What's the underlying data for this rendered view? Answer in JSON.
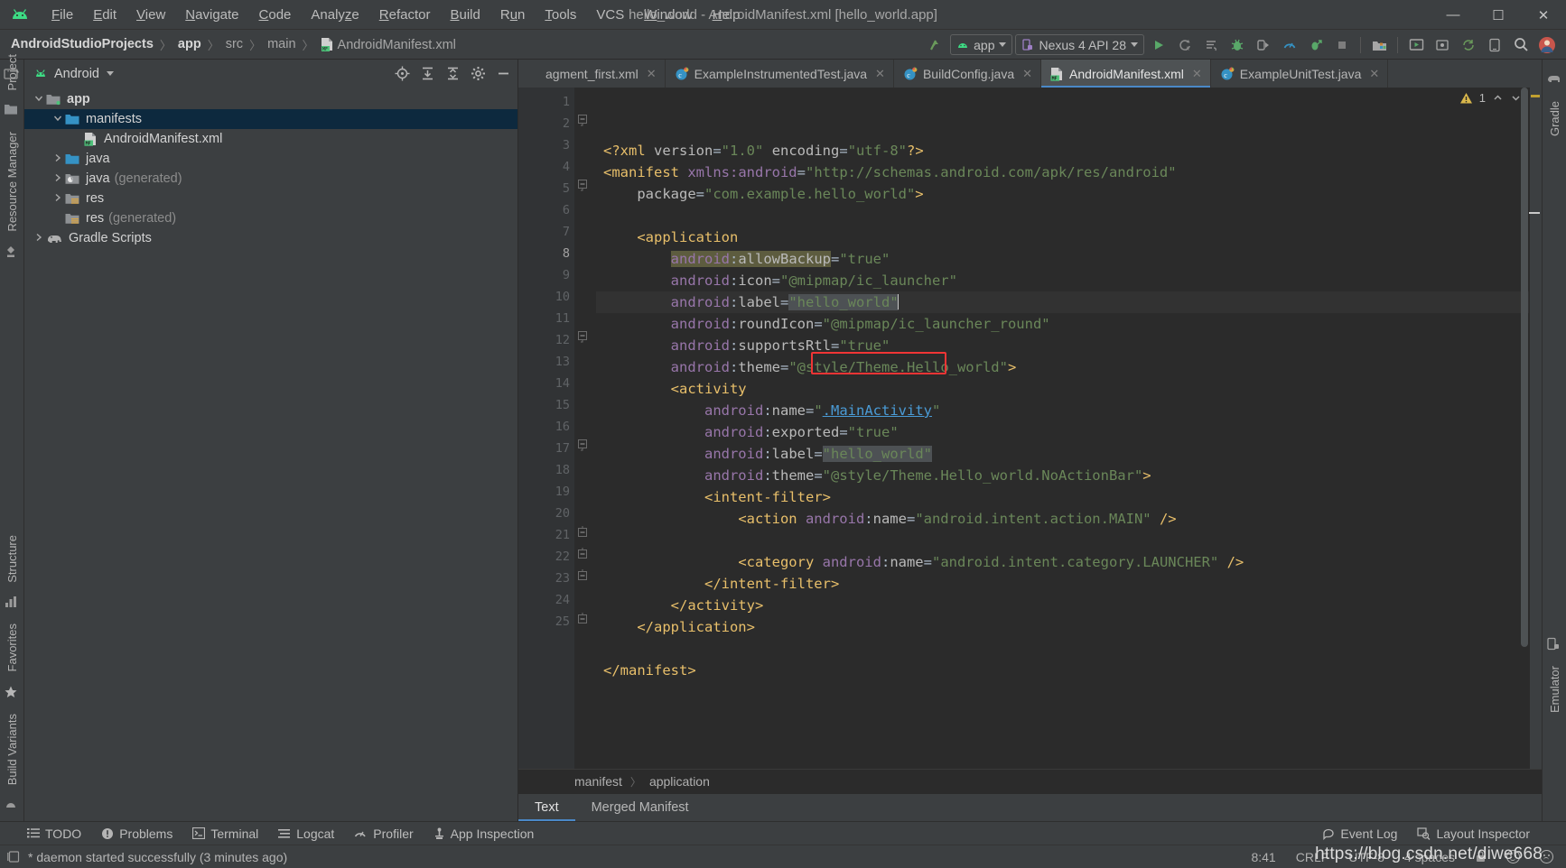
{
  "window": {
    "title": "hello_world - AndroidManifest.xml [hello_world.app]",
    "minimize": "—",
    "maximize": "☐",
    "close": "✕"
  },
  "menu": {
    "items": [
      {
        "label": "File",
        "mnemonic": "F"
      },
      {
        "label": "Edit",
        "mnemonic": "E"
      },
      {
        "label": "View",
        "mnemonic": "V"
      },
      {
        "label": "Navigate",
        "mnemonic": "N"
      },
      {
        "label": "Code",
        "mnemonic": "C"
      },
      {
        "label": "Analyze",
        "mnemonic": "z"
      },
      {
        "label": "Refactor",
        "mnemonic": "R"
      },
      {
        "label": "Build",
        "mnemonic": "B"
      },
      {
        "label": "Run",
        "mnemonic": "u"
      },
      {
        "label": "Tools",
        "mnemonic": "T"
      },
      {
        "label": "VCS",
        "mnemonic": ""
      },
      {
        "label": "Window",
        "mnemonic": "W"
      },
      {
        "label": "Help",
        "mnemonic": "H"
      }
    ]
  },
  "navbar": {
    "breadcrumbs": [
      "AndroidStudioProjects",
      "app",
      "src",
      "main",
      "AndroidManifest.xml"
    ],
    "separator": "〉",
    "module_selector": "app",
    "device_selector": "Nexus 4 API 28",
    "icons": [
      "make-project-icon",
      "run-icon",
      "run-with-coverage-icon",
      "apply-changes-icon",
      "debug-icon",
      "attach-debugger-icon",
      "profiler-icon",
      "debug-attach-icon",
      "stop-icon",
      "sdk-manager-icon",
      "avd-manager-icon",
      "search-everywhere-icon",
      "profile-avatar-icon"
    ]
  },
  "leftstrip": {
    "labels": [
      "Project",
      "Resource Manager",
      "Structure",
      "Favorites",
      "Build Variants"
    ],
    "icons": [
      "project-icon",
      "resource-manager-icon",
      "structure-icon",
      "favorites-star-icon",
      "build-variants-icon"
    ]
  },
  "rightstrip": {
    "labels": [
      "Gradle",
      "Emulator"
    ],
    "icons": [
      "gradle-elephant-icon",
      "emulator-icon"
    ]
  },
  "project_panel": {
    "view_selector": "Android",
    "tool_icons": [
      "locate-icon",
      "expand-all-icon",
      "collapse-all-icon",
      "settings-gear-icon",
      "hide-icon"
    ],
    "tree": [
      {
        "label": "app",
        "depth": 0,
        "arrow": "down",
        "icon": "module-folder-icon",
        "bold": true,
        "dim": "",
        "selected": false
      },
      {
        "label": "manifests",
        "depth": 1,
        "arrow": "down",
        "icon": "folder-icon",
        "bold": false,
        "dim": "",
        "selected": true
      },
      {
        "label": "AndroidManifest.xml",
        "depth": 2,
        "arrow": "none",
        "icon": "manifest-file-icon",
        "bold": false,
        "dim": "",
        "selected": false
      },
      {
        "label": "java",
        "depth": 1,
        "arrow": "right",
        "icon": "folder-icon",
        "bold": false,
        "dim": "",
        "selected": false
      },
      {
        "label": "java",
        "depth": 1,
        "arrow": "right",
        "icon": "folder-generated-icon",
        "bold": false,
        "dim": "(generated)",
        "selected": false
      },
      {
        "label": "res",
        "depth": 1,
        "arrow": "right",
        "icon": "res-folder-icon",
        "bold": false,
        "dim": "",
        "selected": false
      },
      {
        "label": "res",
        "depth": 1,
        "arrow": "none",
        "icon": "res-folder-icon",
        "bold": false,
        "dim": "(generated)",
        "selected": false
      },
      {
        "label": "Gradle Scripts",
        "depth": 0,
        "arrow": "right",
        "icon": "gradle-elephant-icon",
        "bold": false,
        "dim": "",
        "selected": false
      }
    ]
  },
  "editor": {
    "tabs": [
      {
        "label": "agment_first.xml",
        "icon": "xml-layout-icon",
        "active": false,
        "closable": true
      },
      {
        "label": "ExampleInstrumentedTest.java",
        "icon": "java-class-icon",
        "active": false,
        "closable": true
      },
      {
        "label": "BuildConfig.java",
        "icon": "java-class-icon",
        "active": false,
        "closable": true
      },
      {
        "label": "AndroidManifest.xml",
        "icon": "manifest-file-icon",
        "active": true,
        "closable": true
      },
      {
        "label": "ExampleUnitTest.java",
        "icon": "java-class-icon",
        "active": false,
        "closable": true
      }
    ],
    "tab_overflow_icon": "chevron-down-icon",
    "warning_count": "1",
    "warning_icon": "warning-triangle-icon",
    "inspection_up_icon": "chevron-up-icon",
    "inspection_down_icon": "chevron-down-icon",
    "settings_icon": "settings-gear-icon",
    "hide_icon": "hide-minus-icon",
    "cursor_line": 8,
    "lines": [
      {
        "n": 1,
        "gmark": "",
        "fold": "",
        "current": false,
        "parts": [
          {
            "t": "<?xml ",
            "c": "tag"
          },
          {
            "t": "version",
            "c": "attrn"
          },
          {
            "t": "=",
            "c": "punc"
          },
          {
            "t": "\"1.0\"",
            "c": "val"
          },
          {
            "t": " ",
            "c": "punc"
          },
          {
            "t": "encoding",
            "c": "attrn"
          },
          {
            "t": "=",
            "c": "punc"
          },
          {
            "t": "\"utf-8\"",
            "c": "val"
          },
          {
            "t": "?>",
            "c": "tag"
          }
        ]
      },
      {
        "n": 2,
        "gmark": "",
        "fold": "minus",
        "current": false,
        "parts": [
          {
            "t": "<manifest ",
            "c": "tag"
          },
          {
            "t": "xmlns:android",
            "c": "ns"
          },
          {
            "t": "=",
            "c": "punc"
          },
          {
            "t": "\"http://schemas.android.com/apk/res/android\"",
            "c": "val"
          }
        ]
      },
      {
        "n": 3,
        "gmark": "",
        "fold": "",
        "current": false,
        "parts": [
          {
            "t": "    ",
            "c": "punc"
          },
          {
            "t": "package",
            "c": "attrn"
          },
          {
            "t": "=",
            "c": "punc"
          },
          {
            "t": "\"com.example.hello_world\"",
            "c": "val"
          },
          {
            "t": ">",
            "c": "tag"
          }
        ]
      },
      {
        "n": 4,
        "gmark": "",
        "fold": "",
        "current": false,
        "parts": []
      },
      {
        "n": 5,
        "gmark": "",
        "fold": "minus",
        "current": false,
        "parts": [
          {
            "t": "    ",
            "c": "punc"
          },
          {
            "t": "<application",
            "c": "tag"
          }
        ]
      },
      {
        "n": 6,
        "gmark": "",
        "fold": "",
        "current": false,
        "parts": [
          {
            "t": "        ",
            "c": "punc"
          },
          {
            "t": "android",
            "c": "ns hl-bg"
          },
          {
            "t": ":",
            "c": "punc hl-bg"
          },
          {
            "t": "allowBackup",
            "c": "attrn hl-bg"
          },
          {
            "t": "=",
            "c": "punc"
          },
          {
            "t": "\"true\"",
            "c": "val"
          }
        ]
      },
      {
        "n": 7,
        "gmark": "image",
        "fold": "",
        "current": false,
        "parts": [
          {
            "t": "        ",
            "c": "punc"
          },
          {
            "t": "android",
            "c": "ns"
          },
          {
            "t": ":",
            "c": "punc"
          },
          {
            "t": "icon",
            "c": "attrn"
          },
          {
            "t": "=",
            "c": "punc"
          },
          {
            "t": "\"@mipmap/ic_launcher\"",
            "c": "val"
          }
        ]
      },
      {
        "n": 8,
        "gmark": "",
        "fold": "",
        "current": true,
        "parts": [
          {
            "t": "        ",
            "c": "punc"
          },
          {
            "t": "android",
            "c": "ns"
          },
          {
            "t": ":",
            "c": "punc"
          },
          {
            "t": "label",
            "c": "attrn"
          },
          {
            "t": "=",
            "c": "punc"
          },
          {
            "t": "\"hello_world\"",
            "c": "val sel-bg"
          },
          {
            "t": "|CARET|",
            "c": "caret"
          }
        ]
      },
      {
        "n": 9,
        "gmark": "image",
        "fold": "",
        "current": false,
        "parts": [
          {
            "t": "        ",
            "c": "punc"
          },
          {
            "t": "android",
            "c": "ns"
          },
          {
            "t": ":",
            "c": "punc"
          },
          {
            "t": "roundIcon",
            "c": "attrn"
          },
          {
            "t": "=",
            "c": "punc"
          },
          {
            "t": "\"@mipmap/ic_launcher_round\"",
            "c": "val"
          }
        ]
      },
      {
        "n": 10,
        "gmark": "",
        "fold": "",
        "current": false,
        "parts": [
          {
            "t": "        ",
            "c": "punc"
          },
          {
            "t": "android",
            "c": "ns"
          },
          {
            "t": ":",
            "c": "punc"
          },
          {
            "t": "supportsRtl",
            "c": "attrn"
          },
          {
            "t": "=",
            "c": "punc"
          },
          {
            "t": "\"true\"",
            "c": "val"
          }
        ]
      },
      {
        "n": 11,
        "gmark": "",
        "fold": "",
        "current": false,
        "parts": [
          {
            "t": "        ",
            "c": "punc"
          },
          {
            "t": "android",
            "c": "ns"
          },
          {
            "t": ":",
            "c": "punc"
          },
          {
            "t": "theme",
            "c": "attrn"
          },
          {
            "t": "=",
            "c": "punc"
          },
          {
            "t": "\"@style/Theme.Hello_world\"",
            "c": "val"
          },
          {
            "t": ">",
            "c": "tag"
          }
        ]
      },
      {
        "n": 12,
        "gmark": "",
        "fold": "minus",
        "current": false,
        "parts": [
          {
            "t": "        ",
            "c": "punc"
          },
          {
            "t": "<activity",
            "c": "tag"
          }
        ]
      },
      {
        "n": 13,
        "gmark": "",
        "fold": "",
        "current": false,
        "parts": [
          {
            "t": "            ",
            "c": "punc"
          },
          {
            "t": "android",
            "c": "ns"
          },
          {
            "t": ":",
            "c": "punc"
          },
          {
            "t": "name",
            "c": "attrn"
          },
          {
            "t": "=",
            "c": "punc"
          },
          {
            "t": "\"",
            "c": "val"
          },
          {
            "t": ".MainActivity",
            "c": "link"
          },
          {
            "t": "\"",
            "c": "val"
          }
        ]
      },
      {
        "n": 14,
        "gmark": "",
        "fold": "",
        "current": false,
        "parts": [
          {
            "t": "            ",
            "c": "punc"
          },
          {
            "t": "android",
            "c": "ns"
          },
          {
            "t": ":",
            "c": "punc"
          },
          {
            "t": "exported",
            "c": "attrn"
          },
          {
            "t": "=",
            "c": "punc"
          },
          {
            "t": "\"true\"",
            "c": "val"
          }
        ]
      },
      {
        "n": 15,
        "gmark": "",
        "fold": "",
        "current": false,
        "parts": [
          {
            "t": "            ",
            "c": "punc"
          },
          {
            "t": "android",
            "c": "ns"
          },
          {
            "t": ":",
            "c": "punc"
          },
          {
            "t": "label",
            "c": "attrn"
          },
          {
            "t": "=",
            "c": "punc"
          },
          {
            "t": "\"hello_world\"",
            "c": "val sel-bg"
          }
        ]
      },
      {
        "n": 16,
        "gmark": "",
        "fold": "",
        "current": false,
        "parts": [
          {
            "t": "            ",
            "c": "punc"
          },
          {
            "t": "android",
            "c": "ns"
          },
          {
            "t": ":",
            "c": "punc"
          },
          {
            "t": "theme",
            "c": "attrn"
          },
          {
            "t": "=",
            "c": "punc"
          },
          {
            "t": "\"@style/Theme.Hello_world.NoActionBar\"",
            "c": "val"
          },
          {
            "t": ">",
            "c": "tag"
          }
        ]
      },
      {
        "n": 17,
        "gmark": "",
        "fold": "minus",
        "current": false,
        "parts": [
          {
            "t": "            ",
            "c": "punc"
          },
          {
            "t": "<intent-filter>",
            "c": "tag"
          }
        ]
      },
      {
        "n": 18,
        "gmark": "",
        "fold": "",
        "current": false,
        "parts": [
          {
            "t": "                ",
            "c": "punc"
          },
          {
            "t": "<action ",
            "c": "tag"
          },
          {
            "t": "android",
            "c": "ns"
          },
          {
            "t": ":",
            "c": "punc"
          },
          {
            "t": "name",
            "c": "attrn"
          },
          {
            "t": "=",
            "c": "punc"
          },
          {
            "t": "\"android.intent.action.MAIN\"",
            "c": "val"
          },
          {
            "t": " />",
            "c": "tag"
          }
        ]
      },
      {
        "n": 19,
        "gmark": "",
        "fold": "",
        "current": false,
        "parts": []
      },
      {
        "n": 20,
        "gmark": "",
        "fold": "",
        "current": false,
        "parts": [
          {
            "t": "                ",
            "c": "punc"
          },
          {
            "t": "<category ",
            "c": "tag"
          },
          {
            "t": "android",
            "c": "ns"
          },
          {
            "t": ":",
            "c": "punc"
          },
          {
            "t": "name",
            "c": "attrn"
          },
          {
            "t": "=",
            "c": "punc"
          },
          {
            "t": "\"android.intent.category.LAUNCHER\"",
            "c": "val"
          },
          {
            "t": " />",
            "c": "tag"
          }
        ]
      },
      {
        "n": 21,
        "gmark": "",
        "fold": "end",
        "current": false,
        "parts": [
          {
            "t": "            ",
            "c": "punc"
          },
          {
            "t": "</intent-filter>",
            "c": "tag"
          }
        ]
      },
      {
        "n": 22,
        "gmark": "",
        "fold": "end",
        "current": false,
        "parts": [
          {
            "t": "        ",
            "c": "punc"
          },
          {
            "t": "</activity>",
            "c": "tag"
          }
        ]
      },
      {
        "n": 23,
        "gmark": "",
        "fold": "end",
        "current": false,
        "parts": [
          {
            "t": "    ",
            "c": "punc"
          },
          {
            "t": "</application>",
            "c": "tag"
          }
        ]
      },
      {
        "n": 24,
        "gmark": "",
        "fold": "",
        "current": false,
        "parts": []
      },
      {
        "n": 25,
        "gmark": "",
        "fold": "end",
        "current": false,
        "parts": [
          {
            "t": "</manifest>",
            "c": "tag"
          }
        ]
      }
    ],
    "annotation_box": {
      "color": "#f03535",
      "target": ".MainActivity"
    },
    "breadcrumbs": [
      "manifest",
      "application"
    ],
    "breadcrumb_separator": "〉",
    "sub_tabs": [
      {
        "label": "Text",
        "active": true
      },
      {
        "label": "Merged Manifest",
        "active": false
      }
    ]
  },
  "bottom_bar": {
    "items": [
      {
        "label": "TODO",
        "icon": "todo-list-icon"
      },
      {
        "label": "Problems",
        "icon": "problems-icon"
      },
      {
        "label": "Terminal",
        "icon": "terminal-icon"
      },
      {
        "label": "Logcat",
        "icon": "logcat-icon"
      },
      {
        "label": "Profiler",
        "icon": "profiler-icon"
      },
      {
        "label": "App Inspection",
        "icon": "app-inspection-icon"
      }
    ],
    "right_items": [
      {
        "label": "Event Log",
        "icon": "event-log-icon"
      },
      {
        "label": "Layout Inspector",
        "icon": "layout-inspector-icon"
      }
    ]
  },
  "status_bar": {
    "icon": "status-window-icon",
    "message": "* daemon started successfully (3 minutes ago)",
    "caret_position": "8:41",
    "line_separator": "CRLF",
    "encoding": "UTF-8",
    "indent": "4 spaces",
    "lock_icon": "read-only-lock-icon",
    "feedback_happy_icon": "smiley-happy-icon",
    "feedback_sad_icon": "smiley-sad-icon"
  },
  "watermark": "https://blog.csdn.net/diwe668",
  "colors": {
    "accent_blue": "#4a88c7",
    "android_green": "#3ddc84",
    "selection_navy": "#0d293e",
    "editor_bg": "#2b2b2b",
    "chrome_bg": "#3c3f41",
    "annotation_red": "#f03535",
    "xml_tag": "#e8bf6a",
    "xml_value": "#6a8759",
    "xml_ns": "#9876aa",
    "link_blue": "#4a9bd6"
  }
}
